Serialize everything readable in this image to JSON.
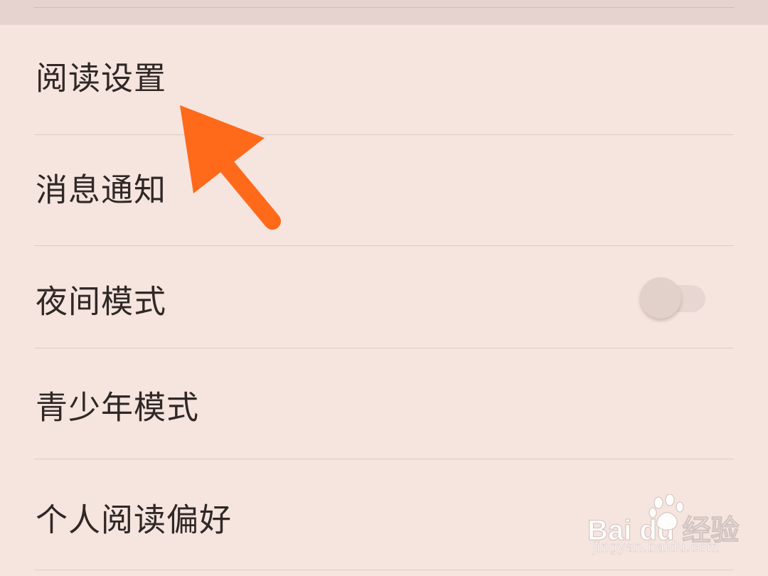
{
  "settings": {
    "items": [
      {
        "label": "阅读设置"
      },
      {
        "label": "消息通知"
      },
      {
        "label": "夜间模式",
        "toggle_on": false
      },
      {
        "label": "青少年模式"
      },
      {
        "label": "个人阅读偏好"
      }
    ]
  },
  "annotation": {
    "arrow_color": "#ff6a1a",
    "points_to": "阅读设置"
  },
  "watermark": {
    "logo_text": "Bai du 经验",
    "url": "jingyan.baidu.com"
  },
  "colors": {
    "background": "#f6e4de",
    "divider": "#ddcac5",
    "text": "#2f2826"
  }
}
